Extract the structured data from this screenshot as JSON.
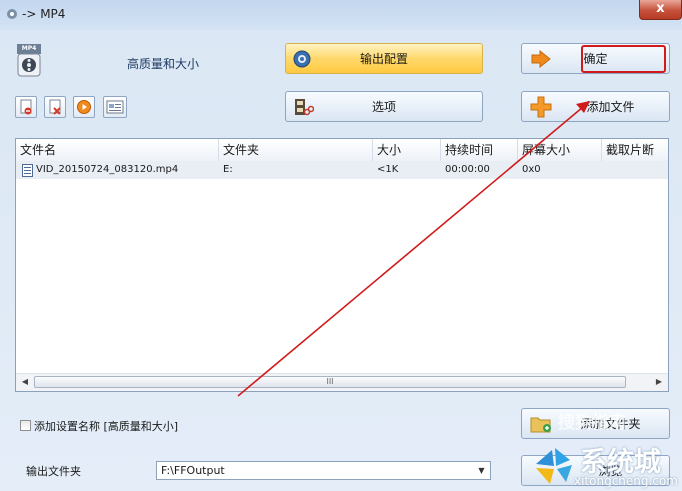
{
  "window": {
    "title": "-> MP4",
    "close_symbol": "x"
  },
  "profile": {
    "label": "高质量和大小",
    "format_icon_text": "MP4"
  },
  "buttons": {
    "output_config": "输出配置",
    "ok": "确定",
    "options": "选项",
    "add_file": "添加文件",
    "add_folder": "添加文件夹",
    "browse": "浏览"
  },
  "file_list": {
    "columns": [
      "文件名",
      "文件夹",
      "大小",
      "持续时间",
      "屏幕大小",
      "截取片断"
    ],
    "rows": [
      {
        "name": "VID_20150724_083120.mp4",
        "folder": "E:",
        "size": "<1K",
        "duration": "00:00:00",
        "screen": "0x0",
        "clip": ""
      }
    ],
    "scroll_grip": "III"
  },
  "options_area": {
    "add_setting_name_label": "添加设置名称 [高质量和大小]",
    "output_folder_label": "输出文件夹",
    "output_folder_value": "F:\\FFOutput"
  },
  "watermark": {
    "brand": "系统城",
    "url": "xitongcheng.com",
    "sogou": "搜狗指南"
  },
  "colors": {
    "annotation_red": "#d11a1a",
    "config_button_gold": "#ffd86b",
    "title_close_red": "#c6513b"
  }
}
